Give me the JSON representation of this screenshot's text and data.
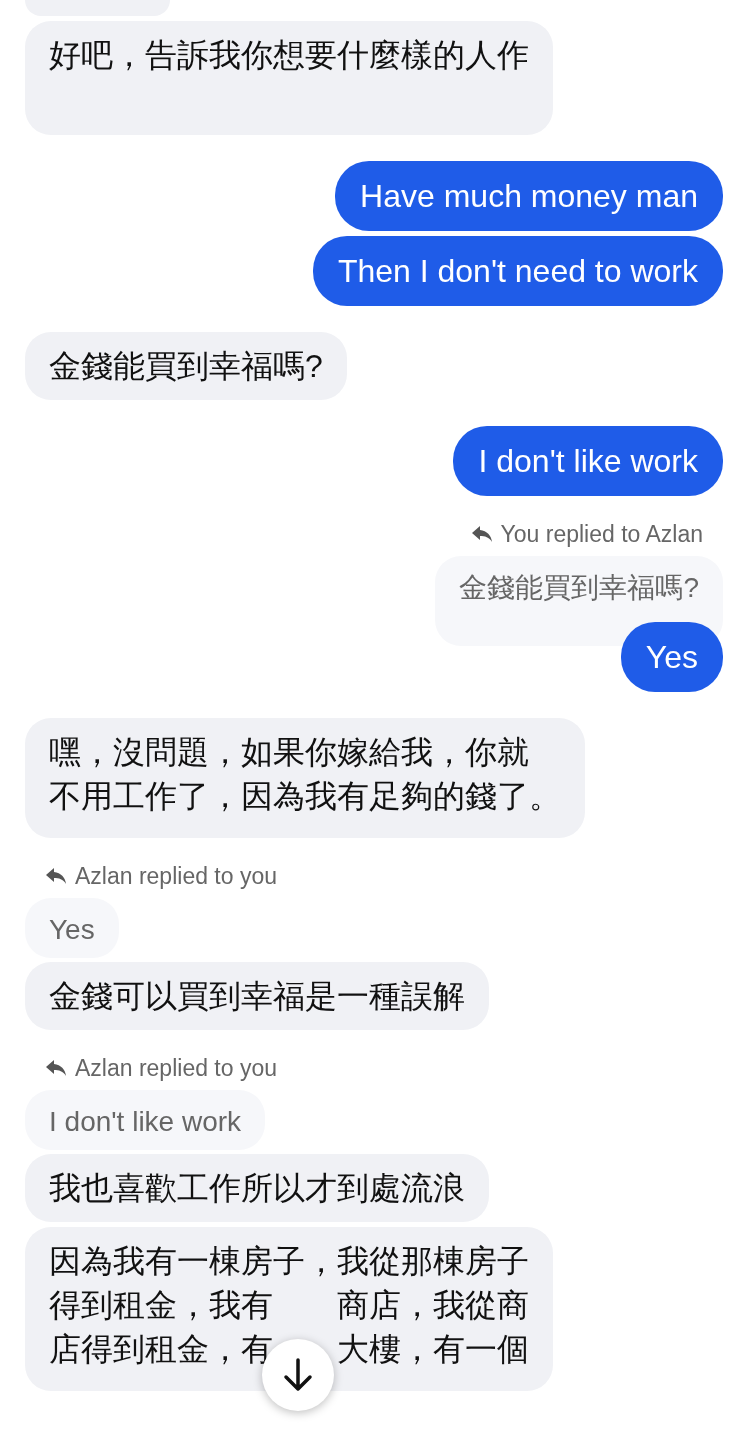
{
  "messages": [
    {
      "kind": "cut_off",
      "outgoing": false
    },
    {
      "kind": "text",
      "outgoing": false,
      "text": "好吧，告訴我你想要什麼樣的人作"
    },
    {
      "kind": "text",
      "outgoing": true,
      "text": "Have much money man"
    },
    {
      "kind": "text",
      "outgoing": true,
      "text": "Then I don't need to work"
    },
    {
      "kind": "text",
      "outgoing": false,
      "text": "金錢能買到幸福嗎?"
    },
    {
      "kind": "text",
      "outgoing": true,
      "text": "I don't like work"
    },
    {
      "kind": "reply_label",
      "outgoing": true,
      "text": "You replied to Azlan"
    },
    {
      "kind": "quoted",
      "outgoing": true,
      "text": "金錢能買到幸福嗎?"
    },
    {
      "kind": "text",
      "outgoing": true,
      "text": "Yes"
    },
    {
      "kind": "text",
      "outgoing": false,
      "lines": [
        [
          "嘿，沒問題，如果你嫁給我，你就"
        ],
        [
          "不用工作了，因為我有足夠的錢了。"
        ]
      ]
    },
    {
      "kind": "reply_label",
      "outgoing": false,
      "text": "Azlan replied to you"
    },
    {
      "kind": "quoted",
      "outgoing": false,
      "text": "Yes"
    },
    {
      "kind": "text",
      "outgoing": false,
      "text": "金錢可以買到幸福是一種誤解"
    },
    {
      "kind": "reply_label",
      "outgoing": false,
      "text": "Azlan replied to you"
    },
    {
      "kind": "quoted",
      "outgoing": false,
      "text": "I don't like work"
    },
    {
      "kind": "text",
      "outgoing": false,
      "text": "我也喜歡工作所以才到處流浪"
    },
    {
      "kind": "text",
      "outgoing": false,
      "lines": [
        [
          "因為我有一棟房子，我從那棟房子"
        ],
        [
          "得到租金，我有",
          "商店，我從商"
        ],
        [
          "店得到租金，有",
          "大樓，有一個"
        ]
      ]
    }
  ],
  "scroll_down_button": {
    "visible": true
  }
}
